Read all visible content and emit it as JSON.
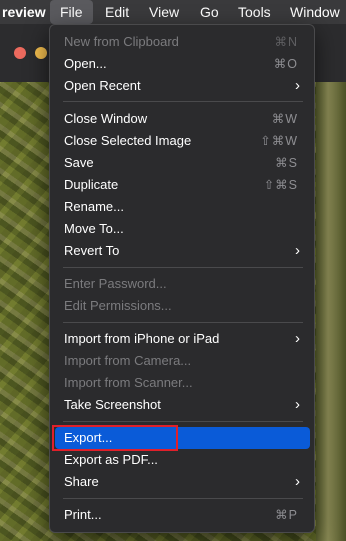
{
  "menubar": {
    "app_name": "review",
    "items": [
      "File",
      "Edit",
      "View",
      "Go",
      "Tools",
      "Window"
    ]
  },
  "file_menu": {
    "items": [
      {
        "label": "New from Clipboard",
        "shortcut": "⌘N",
        "disabled": true
      },
      {
        "label": "Open...",
        "shortcut": "⌘O"
      },
      {
        "label": "Open Recent",
        "submenu": true
      },
      {
        "label": "Close Window",
        "shortcut": "⌘W"
      },
      {
        "label": "Close Selected Image",
        "shortcut": "⇧⌘W"
      },
      {
        "label": "Save",
        "shortcut": "⌘S"
      },
      {
        "label": "Duplicate",
        "shortcut": "⇧⌘S"
      },
      {
        "label": "Rename..."
      },
      {
        "label": "Move To..."
      },
      {
        "label": "Revert To",
        "submenu": true
      },
      {
        "label": "Enter Password...",
        "disabled": true
      },
      {
        "label": "Edit Permissions...",
        "disabled": true
      },
      {
        "label": "Import from iPhone or iPad",
        "submenu": true
      },
      {
        "label": "Import from Camera...",
        "disabled": true
      },
      {
        "label": "Import from Scanner...",
        "disabled": true
      },
      {
        "label": "Take Screenshot",
        "submenu": true
      },
      {
        "label": "Export...",
        "highlighted": true
      },
      {
        "label": "Export as PDF..."
      },
      {
        "label": "Share",
        "submenu": true
      },
      {
        "label": "Print...",
        "shortcut": "⌘P"
      }
    ],
    "submenu_arrow": "›"
  },
  "colors": {
    "highlight": "#0a5bd8",
    "focus_outline": "#e0202a",
    "menu_bg": "#2b2b2d"
  }
}
